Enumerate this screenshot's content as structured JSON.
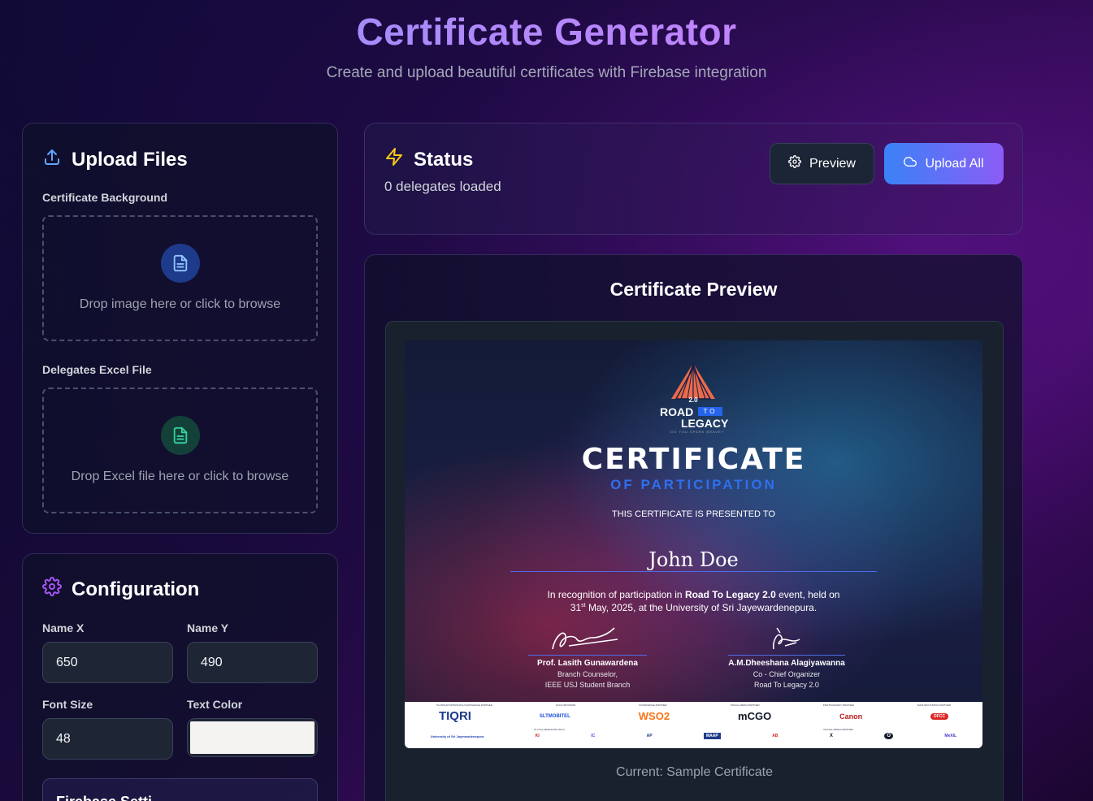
{
  "header": {
    "title": "Certificate Generator",
    "subtitle": "Create and upload beautiful certificates with Firebase integration"
  },
  "upload": {
    "title": "Upload Files",
    "background_label": "Certificate Background",
    "background_drop_text": "Drop image here or click to browse",
    "excel_label": "Delegates Excel File",
    "excel_drop_text": "Drop Excel file here or click to browse"
  },
  "config": {
    "title": "Configuration",
    "name_x_label": "Name X",
    "name_x_value": "650",
    "name_y_label": "Name Y",
    "name_y_value": "490",
    "font_size_label": "Font Size",
    "font_size_value": "48",
    "text_color_label": "Text Color",
    "text_color_value": "#f5f2f2",
    "firebase_section_partial": "Firebase Setti..."
  },
  "status": {
    "title": "Status",
    "text": "0 delegates loaded",
    "preview_button": "Preview",
    "upload_button": "Upload All"
  },
  "preview": {
    "title": "Certificate Preview",
    "current_label": "Current: Sample Certificate"
  },
  "certificate": {
    "logo_version": "2.0",
    "logo_road": "ROAD",
    "logo_to": "TO",
    "logo_legacy": "LEGACY",
    "logo_tagline": "DO YOU SPARK BRAVE?",
    "heading": "CERTIFICATE",
    "subheading": "OF PARTICIPATION",
    "presented_to": "THIS CERTIFICATE IS PRESENTED TO",
    "recipient_name": "John Doe",
    "recognition_pre": "In recognition of participation in ",
    "recognition_event": "Road To Legacy 2.0",
    "recognition_post": " event, held on",
    "recognition_line2_day": "31",
    "recognition_line2_sup": "st",
    "recognition_line2_rest": " May, 2025, at the University of Sri Jayewardenepura.",
    "signatories": [
      {
        "name": "Prof. Lasith Gunawardena",
        "role1": "Branch Counselor,",
        "role2": "IEEE USJ Student Branch"
      },
      {
        "name": "A.M.Dheeshana Alagiyawanna",
        "role1": "Co - Chief Organizer",
        "role2": "Road To Legacy 2.0"
      }
    ],
    "sponsors_top": [
      "TIQRI",
      "SLTMOBITEL",
      "WSO2",
      "mCGO",
      "Canon",
      "DFCC"
    ],
    "sponsors_top_captions": [
      "PLATINUM SPONSOR & KNOWLEDGE PARTNER",
      "GOLD SPONSOR",
      "KNOWLEDGE PARTNER",
      "SOCIAL MEDIA PARTNER",
      "PHOTOGRAPHY PARTNER",
      "MANUFACTURING PARTNER"
    ],
    "sponsors_bottom": [
      "University of Sri Jayewardenepura",
      "KI",
      "IC",
      "AP",
      "MAAP",
      "AB",
      "X",
      "O",
      "MeXiL"
    ],
    "sponsors_bottom_captions": [
      "IN COLLABORATION WITH",
      "DIGITAL MEDIA PARTNER"
    ]
  },
  "colors": {
    "accent_purple": "#a78bfa",
    "upload_gradient_start": "#3b82f6",
    "upload_gradient_end": "#8b5cf6",
    "icon_blue": "#60a5fa",
    "icon_green": "#34d399",
    "icon_yellow": "#facc15",
    "icon_purple": "#a855f7"
  }
}
